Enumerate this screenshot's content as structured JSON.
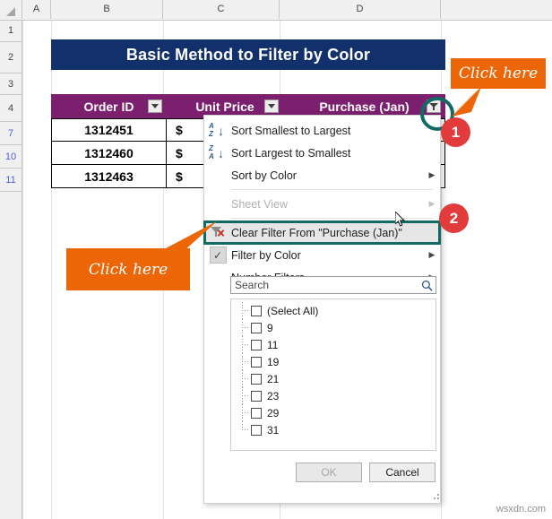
{
  "spreadsheet": {
    "column_headers": [
      "A",
      "B",
      "C",
      "D"
    ],
    "row_headers": [
      {
        "num": "1",
        "filtered": false
      },
      {
        "num": "2",
        "filtered": false
      },
      {
        "num": "3",
        "filtered": false
      },
      {
        "num": "4",
        "filtered": false
      },
      {
        "num": "7",
        "filtered": true
      },
      {
        "num": "10",
        "filtered": true
      },
      {
        "num": "11",
        "filtered": true
      }
    ],
    "title_banner": "Basic Method to Filter by Color",
    "table": {
      "headers": [
        "Order ID",
        "Unit Price",
        "Purchase (Jan)"
      ],
      "rows": [
        [
          "1312451",
          "$",
          ""
        ],
        [
          "1312460",
          "$",
          ""
        ],
        [
          "1312463",
          "$",
          ""
        ]
      ]
    }
  },
  "filter_menu": {
    "items": [
      {
        "label": "Sort Smallest to Largest",
        "icon": "sort-ascending-icon",
        "submenu": false,
        "disabled": false
      },
      {
        "label": "Sort Largest to Smallest",
        "icon": "sort-descending-icon",
        "submenu": false,
        "disabled": false
      },
      {
        "label": "Sort by Color",
        "icon": "none",
        "submenu": true,
        "disabled": false
      },
      {
        "label": "Sheet View",
        "icon": "none",
        "submenu": true,
        "disabled": true
      },
      {
        "label": "Clear Filter From \"Purchase (Jan)\"",
        "icon": "clear-filter-icon",
        "submenu": false,
        "disabled": false,
        "highlighted": true
      },
      {
        "label": "Filter by Color",
        "icon": "checkmark-icon",
        "submenu": true,
        "disabled": false
      },
      {
        "label": "Number Filters",
        "icon": "none",
        "submenu": true,
        "disabled": false
      }
    ],
    "search": {
      "value": "",
      "placeholder": "Search",
      "icon": "magnifier-icon"
    },
    "checklist": [
      {
        "label": "(Select All)",
        "checked": false
      },
      {
        "label": "9",
        "checked": false
      },
      {
        "label": "11",
        "checked": false
      },
      {
        "label": "19",
        "checked": false
      },
      {
        "label": "21",
        "checked": false
      },
      {
        "label": "23",
        "checked": false
      },
      {
        "label": "29",
        "checked": false
      },
      {
        "label": "31",
        "checked": false
      }
    ],
    "buttons": {
      "ok": "OK",
      "cancel": "Cancel"
    }
  },
  "annotations": {
    "callout_1": "Click here",
    "callout_2": "Click here",
    "badge_1": "1",
    "badge_2": "2"
  },
  "watermark": "wsxdn.com",
  "colors": {
    "banner": "#12306b",
    "table_header": "#7b1f6e",
    "callout": "#ec6608",
    "badge": "#e23b3b",
    "highlight_outline": "#116b63"
  }
}
